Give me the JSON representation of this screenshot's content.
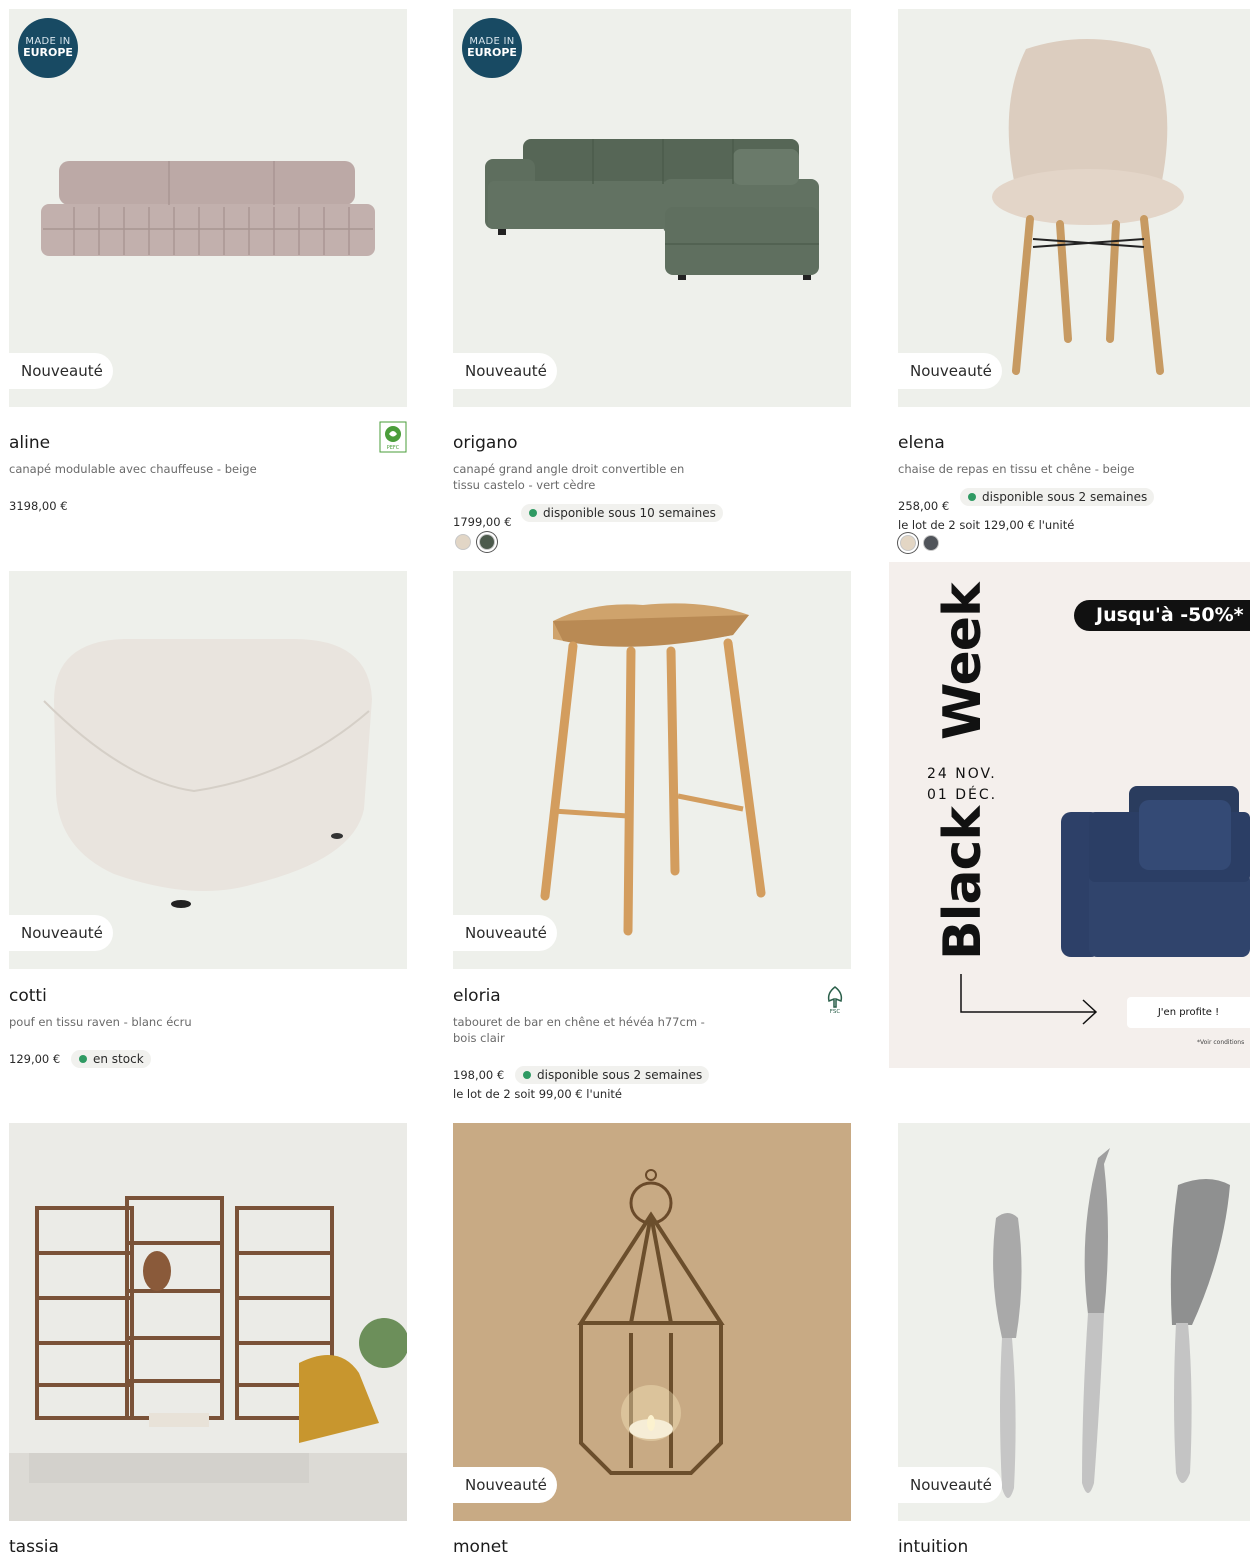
{
  "badges": {
    "new": "Nouveauté",
    "made_in_line1": "MADE IN",
    "made_in_line2": "EUROPE"
  },
  "products": [
    {
      "name": "aline",
      "desc": "canapé modulable avec chauffeuse - beige",
      "price": "3198,00 €"
    },
    {
      "name": "origano",
      "desc": "canapé grand angle droit convertible en tissu castelo - vert cèdre",
      "price": "1799,00 €",
      "availability": "disponible sous 10 semaines"
    },
    {
      "name": "elena",
      "desc": "chaise de repas en tissu et chêne - beige",
      "price": "258,00 €",
      "availability": "disponible sous 2 semaines",
      "lot": "le lot de 2 soit 129,00 € l'unité"
    },
    {
      "name": "cotti",
      "desc": "pouf en tissu raven - blanc écru",
      "price": "129,00 €",
      "availability": "en stock"
    },
    {
      "name": "eloria",
      "desc": "tabouret de bar en chêne et hévéa h77cm - bois clair",
      "price": "198,00 €",
      "availability": "disponible sous 2 semaines",
      "lot": "le lot de 2 soit 99,00 € l'unité"
    },
    {
      "name": "tassia"
    },
    {
      "name": "monet"
    },
    {
      "name": "intuition"
    }
  ],
  "swatch_colors": {
    "origano": [
      "#e2d6c6",
      "#4c5a4c"
    ],
    "elena": [
      "#e3d6c4",
      "#50545a"
    ]
  },
  "promo": {
    "word1": "Black",
    "word2": "Week",
    "discount": "Jusqu'à -50%*",
    "date_start": "24 NOV.",
    "date_end": "01 DÉC.",
    "cta": "J'en profite !",
    "conditions": "*Voir conditions"
  },
  "colors": {
    "accent_navy": "#184a63",
    "availability_green": "#2f9a63",
    "card_bg": "#eef0eb"
  }
}
